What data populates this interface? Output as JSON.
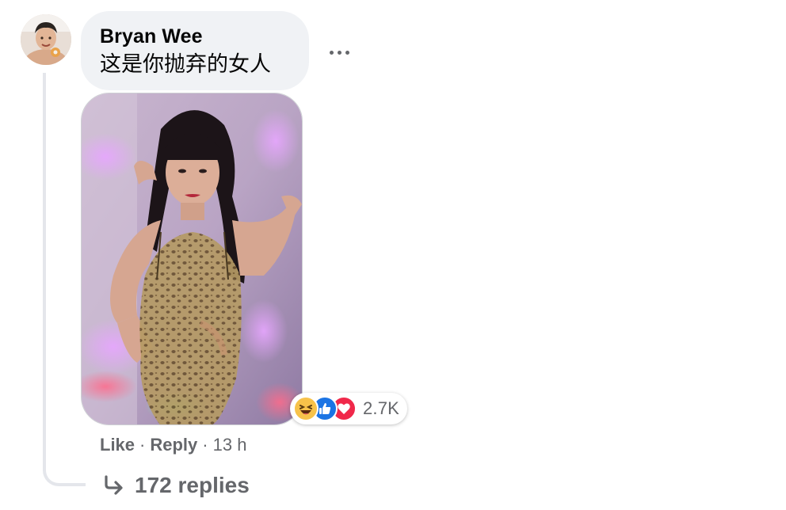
{
  "comment": {
    "author": "Bryan Wee",
    "text": "这是你抛弃的女人",
    "avatar_icon": "user-avatar",
    "more_icon": "more-horizontal-icon",
    "attachment": {
      "type": "photo"
    },
    "reactions": {
      "icons": [
        "haha-icon",
        "like-icon",
        "love-icon"
      ],
      "count": "2.7K",
      "colors": {
        "haha": "#f7c24a",
        "like": "#1b74e4",
        "love": "#f0284a"
      }
    },
    "actions": {
      "like_label": "Like",
      "separator": "·",
      "reply_label": "Reply",
      "time": "13 h"
    },
    "replies": {
      "label": "172 replies",
      "icon": "reply-arrow-icon"
    }
  },
  "theme": {
    "bubble_bg": "#f0f2f5",
    "secondary_text": "#65676b",
    "thread_line": "#e4e6eb"
  }
}
